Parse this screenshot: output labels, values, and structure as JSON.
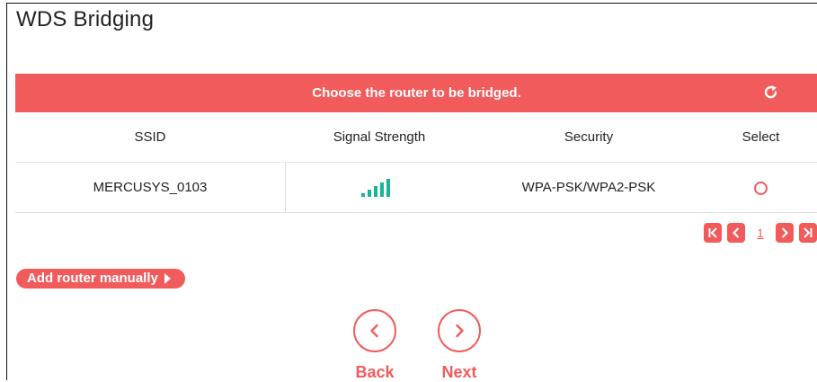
{
  "page": {
    "title": "WDS Bridging"
  },
  "banner": {
    "text": "Choose the router to be bridged.",
    "refresh_icon": "refresh-icon"
  },
  "table": {
    "columns": [
      "SSID",
      "Signal Strength",
      "Security",
      "Select"
    ],
    "rows": [
      {
        "ssid": "MERCUSYS_0103",
        "signal_bars": 5,
        "signal_max": 5,
        "security": "WPA-PSK/WPA2-PSK",
        "selected": false
      }
    ]
  },
  "pagination": {
    "first_icon": "first-page-icon",
    "prev_icon": "prev-page-icon",
    "current_page": "1",
    "next_icon": "next-page-icon",
    "last_icon": "last-page-icon"
  },
  "actions": {
    "add_router_label": "Add router manually",
    "back_label": "Back",
    "next_label": "Next"
  },
  "colors": {
    "accent": "#f25b5b",
    "signal": "#16b59b"
  }
}
